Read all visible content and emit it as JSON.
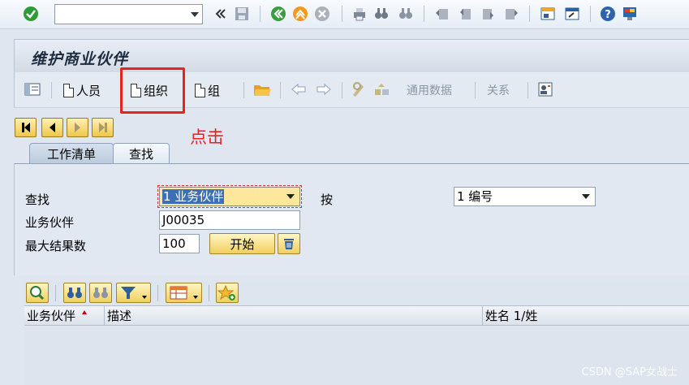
{
  "system_toolbar": {
    "command_field_value": "",
    "icons": [
      "enter-icon",
      "back-icon",
      "save-icon",
      "green-back-icon",
      "exit-icon",
      "cancel-icon",
      "print-icon",
      "find-icon",
      "find-next-icon",
      "first-page-icon",
      "previous-page-icon",
      "next-page-icon",
      "last-page-icon",
      "new-session-icon",
      "shortcut-icon",
      "help-icon",
      "customize-layout-icon"
    ]
  },
  "title": "维护商业伙伴",
  "app_toolbar": {
    "person_label": "人员",
    "organization_label": "组织",
    "group_label": "组",
    "general_data_label": "通用数据",
    "relations_label": "关系"
  },
  "annotation_text": "点击",
  "tabs": [
    {
      "label": "工作清单",
      "active": false
    },
    {
      "label": "查找",
      "active": true
    }
  ],
  "search": {
    "find_label": "查找",
    "find_value": "1 业务伙伴",
    "by_label": "按",
    "by_value": "1 编号",
    "bp_label": "业务伙伴",
    "bp_value": "J00035",
    "max_results_label": "最大结果数",
    "max_results_value": "100",
    "start_button": "开始"
  },
  "results_table": {
    "columns": [
      "业务伙伴",
      "描述",
      "姓名 1/姓"
    ],
    "rows": []
  },
  "watermark": "CSDN @SAP女战士",
  "colors": {
    "accent_red": "#e8231e",
    "button_yellow": "#f2cf5d",
    "background": "#dfe6ef"
  }
}
